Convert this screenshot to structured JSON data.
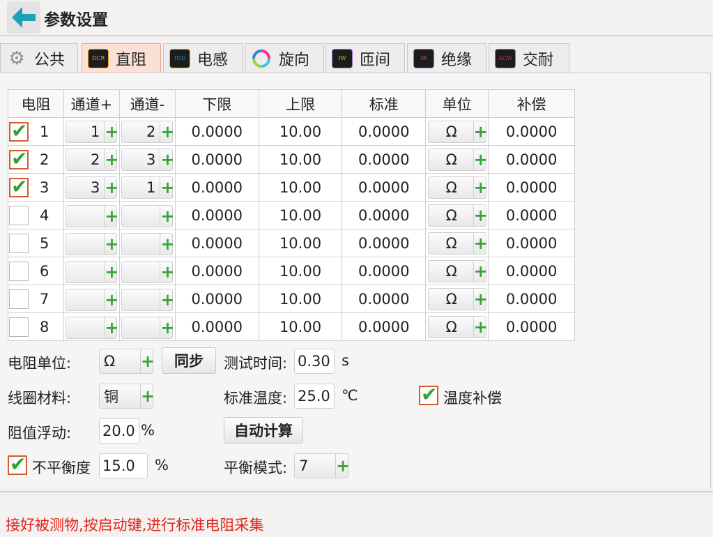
{
  "header": {
    "title": "参数设置"
  },
  "tabs": [
    {
      "label": "公共",
      "icon": "gear-icon"
    },
    {
      "label": "直阻",
      "icon_text": "DCR",
      "icon_color": "#e2a020",
      "active": true
    },
    {
      "label": "电感",
      "icon_text": "IND",
      "icon_color": "#2f7fd8"
    },
    {
      "label": "旋向",
      "icon": "rotation-icon"
    },
    {
      "label": "匝间",
      "icon_text": "IW",
      "icon_color": "#e0c020"
    },
    {
      "label": "绝缘",
      "icon_text": "IR",
      "icon_color": "#e04060"
    },
    {
      "label": "交耐",
      "icon_text": "ACW",
      "icon_color": "#e02080"
    }
  ],
  "table": {
    "headers": [
      "电阻",
      "通道+",
      "通道-",
      "下限",
      "上限",
      "标准",
      "单位",
      "补偿"
    ],
    "rows": [
      {
        "checked": true,
        "no": "1",
        "ch_plus": "1",
        "ch_minus": "2",
        "lower": "0.0000",
        "upper": "10.00",
        "standard": "0.0000",
        "unit": "Ω",
        "comp": "0.0000"
      },
      {
        "checked": true,
        "no": "2",
        "ch_plus": "2",
        "ch_minus": "3",
        "lower": "0.0000",
        "upper": "10.00",
        "standard": "0.0000",
        "unit": "Ω",
        "comp": "0.0000"
      },
      {
        "checked": true,
        "no": "3",
        "ch_plus": "3",
        "ch_minus": "1",
        "lower": "0.0000",
        "upper": "10.00",
        "standard": "0.0000",
        "unit": "Ω",
        "comp": "0.0000"
      },
      {
        "checked": false,
        "no": "4",
        "ch_plus": "",
        "ch_minus": "",
        "lower": "0.0000",
        "upper": "10.00",
        "standard": "0.0000",
        "unit": "Ω",
        "comp": "0.0000"
      },
      {
        "checked": false,
        "no": "5",
        "ch_plus": "",
        "ch_minus": "",
        "lower": "0.0000",
        "upper": "10.00",
        "standard": "0.0000",
        "unit": "Ω",
        "comp": "0.0000"
      },
      {
        "checked": false,
        "no": "6",
        "ch_plus": "",
        "ch_minus": "",
        "lower": "0.0000",
        "upper": "10.00",
        "standard": "0.0000",
        "unit": "Ω",
        "comp": "0.0000"
      },
      {
        "checked": false,
        "no": "7",
        "ch_plus": "",
        "ch_minus": "",
        "lower": "0.0000",
        "upper": "10.00",
        "standard": "0.0000",
        "unit": "Ω",
        "comp": "0.0000"
      },
      {
        "checked": false,
        "no": "8",
        "ch_plus": "",
        "ch_minus": "",
        "lower": "0.0000",
        "upper": "10.00",
        "standard": "0.0000",
        "unit": "Ω",
        "comp": "0.0000"
      }
    ]
  },
  "form": {
    "res_unit_label": "电阻单位:",
    "res_unit_value": "Ω",
    "sync_button": "同步",
    "test_time_label": "测试时间:",
    "test_time_value": "0.30",
    "test_time_unit": "s",
    "coil_material_label": "线圈材料:",
    "coil_material_value": "铜",
    "std_temp_label": "标准温度:",
    "std_temp_value": "25.0",
    "std_temp_unit": "℃",
    "temp_comp_label": "温度补偿",
    "temp_comp_checked": true,
    "float_label": "阻值浮动:",
    "float_value": "20.0",
    "float_unit": "%",
    "auto_calc_button": "自动计算",
    "unbalance_label": "不平衡度",
    "unbalance_checked": true,
    "unbalance_value": "15.0",
    "unbalance_unit": "%",
    "balance_mode_label": "平衡模式:",
    "balance_mode_value": "7"
  },
  "status": {
    "message": "接好被测物,按启动键,进行标准电阻采集"
  },
  "colors": {
    "accent_tab": "#fbe0d6",
    "check_border": "#d45b2c",
    "check_mark": "#2ea32e",
    "plus": "#39a339",
    "status_text": "#e2231a",
    "back_arrow": "#1aa3b8"
  }
}
